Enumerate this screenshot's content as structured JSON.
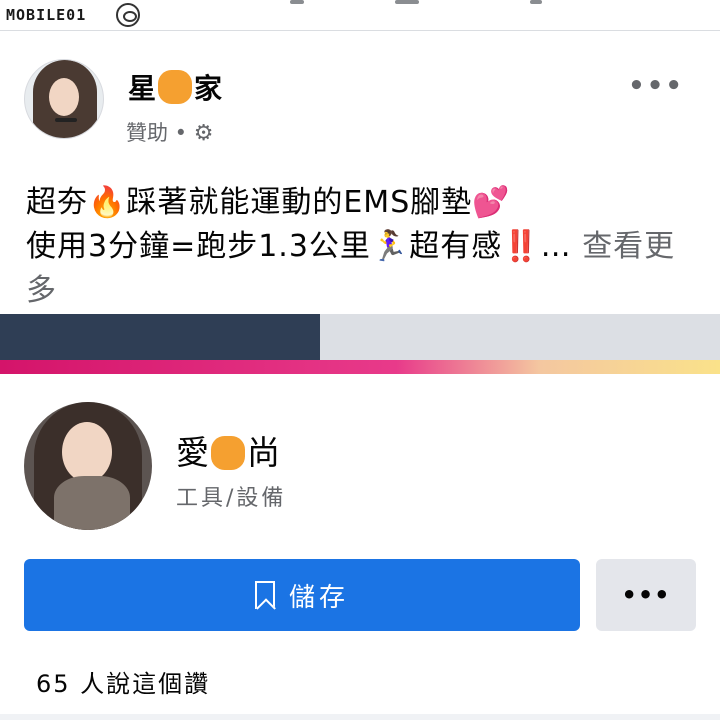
{
  "watermark": {
    "text": "MOBILE01"
  },
  "post": {
    "page_name_prefix": "星",
    "page_name_suffix": "家",
    "sponsored": "贊助 •",
    "text_line1": "超夯🔥踩著就能運動的EMS腳墊💕",
    "text_line2": "使用3分鐘=跑步1.3公里🏃‍♀️超有感‼️…",
    "see_more": "查看更多"
  },
  "card": {
    "name_prefix": "愛",
    "name_suffix": "尚",
    "category": "工具/設備",
    "save_label": "儲存",
    "likes": "65 人說這個讚"
  },
  "icons": {
    "gear": "gear-icon",
    "bookmark": "bookmark-icon",
    "more": "more-icon"
  },
  "colors": {
    "primary": "#1b74e4",
    "secondary_button": "#e4e6eb",
    "muted_text": "#65676b"
  }
}
